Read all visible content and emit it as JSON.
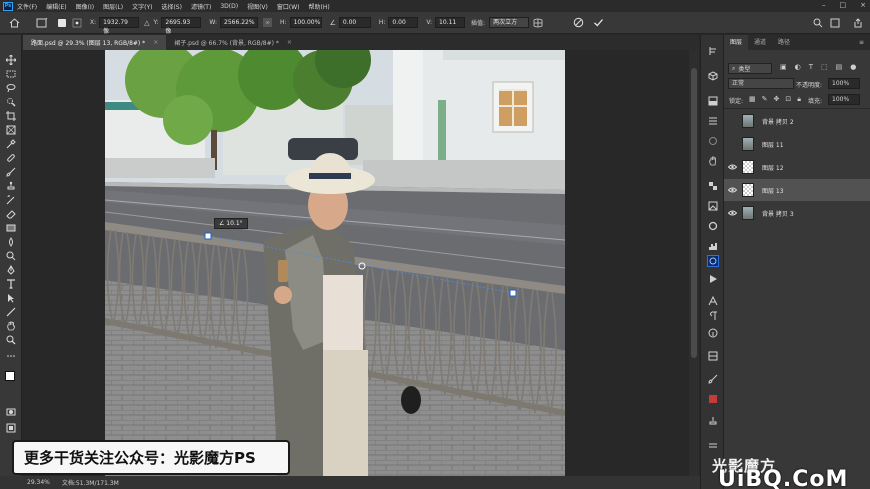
{
  "app": {
    "logo": "Ps"
  },
  "menu": [
    "文件(F)",
    "编辑(E)",
    "图像(I)",
    "图层(L)",
    "文字(Y)",
    "选择(S)",
    "滤镜(T)",
    "3D(D)",
    "视图(V)",
    "窗口(W)",
    "帮助(H)"
  ],
  "options": {
    "x_label": "X:",
    "x_value": "1932.79 像",
    "y_label": "Y:",
    "y_value": "2695.93 像",
    "w_label": "W:",
    "w_value": "2566.22%",
    "h_label": "H:",
    "h_value": "100.00%",
    "angle_value": "0.00",
    "hskew_label": "H:",
    "hskew_value": "0.00",
    "vskew_label": "V:",
    "vskew_value": "10.11",
    "interp_label": "插值:",
    "interp_value": "两次立方"
  },
  "tabs": [
    {
      "label": "路面.psd @ 29.3% (图层 13, RGB/8#) *",
      "close": "×"
    },
    {
      "label": "裙子.psd @ 66.7% (背景, RGB/8#) *",
      "close": "×"
    }
  ],
  "canvas": {
    "angle_readout": "∠ 10.1°"
  },
  "status": {
    "zoom": "29.34%",
    "doc": "文档:51.3M/171.3M"
  },
  "layers_panel": {
    "tabs": [
      "图层",
      "通道",
      "路径"
    ],
    "kind_label": "类型",
    "blend_mode": "正常",
    "opacity_label": "不透明度:",
    "opacity_value": "100%",
    "lock_label": "锁定:",
    "fill_label": "填充:",
    "fill_value": "100%",
    "layers": [
      {
        "name": "背景 拷贝 2",
        "visible": false,
        "selected": false
      },
      {
        "name": "图层 11",
        "visible": false,
        "selected": false
      },
      {
        "name": "图层 12",
        "visible": true,
        "selected": false
      },
      {
        "name": "图层 13",
        "visible": true,
        "selected": true
      },
      {
        "name": "背景 拷贝 3",
        "visible": true,
        "selected": false
      }
    ]
  },
  "watermark": {
    "caption": "更多干货关注公众号：光影魔方PS",
    "right_text": "光影魔方",
    "site": "UiBQ.CoM"
  }
}
